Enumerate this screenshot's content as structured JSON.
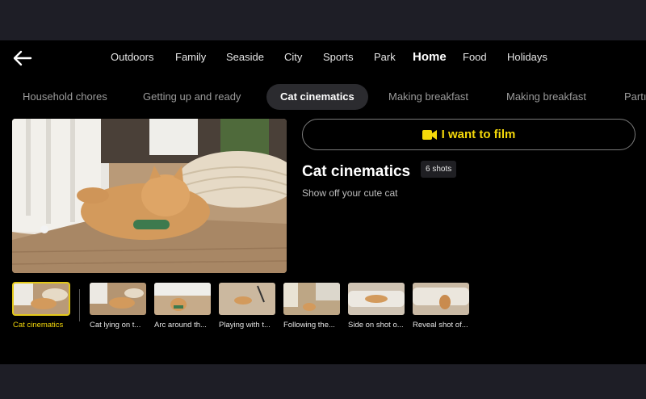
{
  "nav": {
    "back_icon": "arrow-left-icon",
    "categories": [
      "Outdoors",
      "Family",
      "Seaside",
      "City",
      "Sports",
      "Park",
      "Home",
      "Food",
      "Holidays"
    ],
    "active_category": "Home"
  },
  "subcategories": [
    "Household chores",
    "Getting up and ready",
    "Cat cinematics",
    "Making breakfast",
    "Making breakfast",
    "Partı"
  ],
  "detail": {
    "film_button_label": "I want to film",
    "film_icon": "video-camera-icon",
    "title": "Cat cinematics",
    "shots_badge": "6 shots",
    "description": "Show off your cute cat"
  },
  "thumbnails": [
    "Cat cinematics",
    "Cat lying on t...",
    "Arc around th...",
    "Playing with t...",
    "Following the...",
    "Side on shot o...",
    "Reveal shot of..."
  ],
  "colors": {
    "accent": "#f5d90a",
    "background": "#000000",
    "chip": "#2b2b2f"
  }
}
